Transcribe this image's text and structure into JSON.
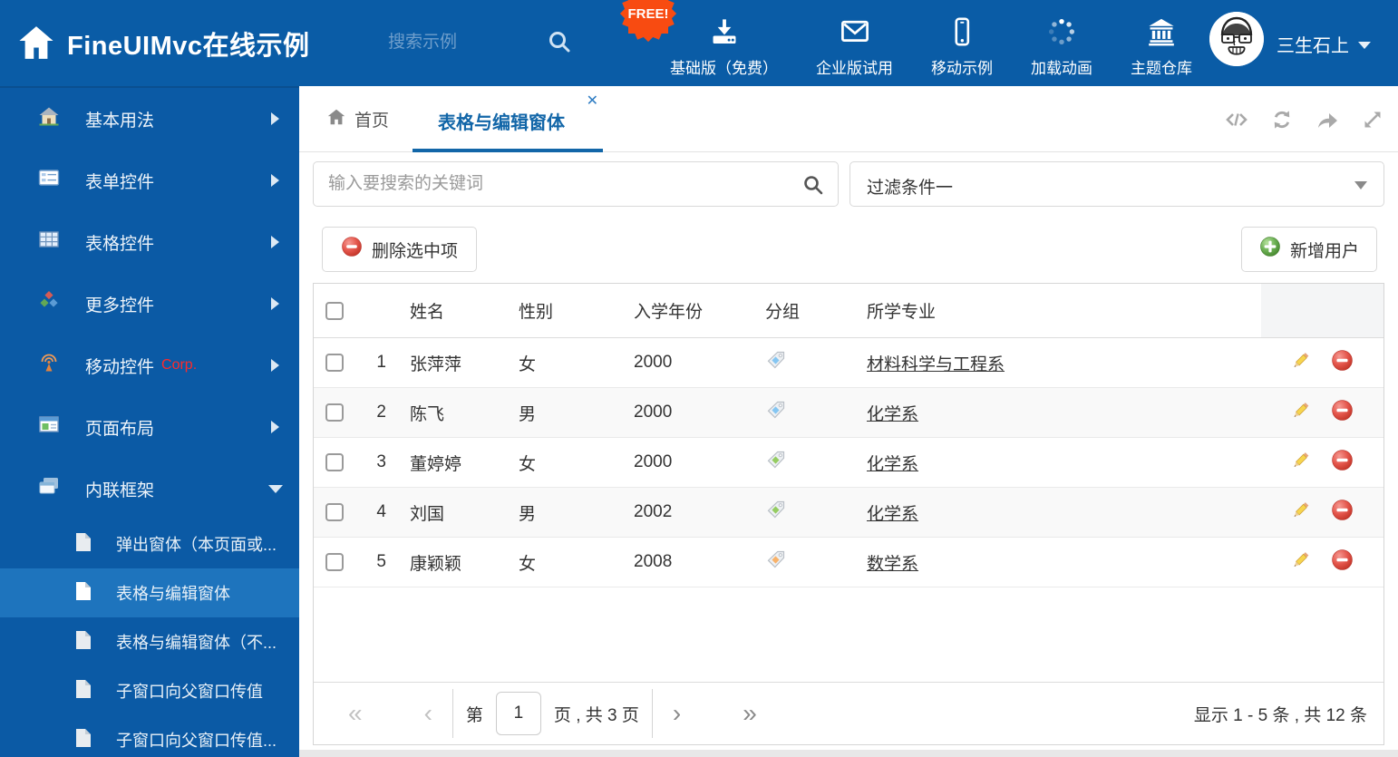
{
  "header": {
    "title": "FineUIMvc在线示例",
    "search_placeholder": "搜索示例",
    "free_badge": "FREE!",
    "nav_items": [
      {
        "icon": "download-icon",
        "label": "基础版（免费）"
      },
      {
        "icon": "envelope-icon",
        "label": "企业版试用"
      },
      {
        "icon": "mobile-icon",
        "label": "移动示例"
      },
      {
        "icon": "spinner-icon",
        "label": "加载动画"
      },
      {
        "icon": "bank-icon",
        "label": "主题仓库"
      }
    ],
    "username": "三生石上"
  },
  "sidebar": {
    "items": [
      {
        "icon": "home-icon",
        "label": "基本用法"
      },
      {
        "icon": "form-icon",
        "label": "表单控件"
      },
      {
        "icon": "table-icon",
        "label": "表格控件"
      },
      {
        "icon": "cubes-icon",
        "label": "更多控件"
      },
      {
        "icon": "antenna-icon",
        "label": "移动控件",
        "badge": "Corp."
      },
      {
        "icon": "layout-icon",
        "label": "页面布局"
      },
      {
        "icon": "frames-icon",
        "label": "内联框架",
        "expanded": true
      }
    ],
    "subitems": [
      {
        "label": "弹出窗体（本页面或..."
      },
      {
        "label": "表格与编辑窗体",
        "selected": true
      },
      {
        "label": "表格与编辑窗体（不..."
      },
      {
        "label": "子窗口向父窗口传值"
      },
      {
        "label": "子窗口向父窗口传值..."
      }
    ]
  },
  "tabs": [
    {
      "label": "首页"
    },
    {
      "label": "表格与编辑窗体",
      "active": true,
      "close_glyph": "✕"
    }
  ],
  "filter": {
    "search_placeholder": "输入要搜索的关键词",
    "dropdown_value": "过滤条件一"
  },
  "toolbar": {
    "delete_label": "删除选中项",
    "add_label": "新增用户"
  },
  "table": {
    "columns": {
      "name": "姓名",
      "gender": "性别",
      "year": "入学年份",
      "group": "分组",
      "major": "所学专业"
    },
    "rows": [
      {
        "num": "1",
        "name": "张萍萍",
        "gender": "女",
        "year": "2000",
        "tag_color": "#85c6f2",
        "major": "材料科学与工程系"
      },
      {
        "num": "2",
        "name": "陈飞",
        "gender": "男",
        "year": "2000",
        "tag_color": "#85c6f2",
        "major": "化学系"
      },
      {
        "num": "3",
        "name": "董婷婷",
        "gender": "女",
        "year": "2000",
        "tag_color": "#95cc62",
        "major": "化学系"
      },
      {
        "num": "4",
        "name": "刘国",
        "gender": "男",
        "year": "2002",
        "tag_color": "#95cc62",
        "major": "化学系"
      },
      {
        "num": "5",
        "name": "康颖颖",
        "gender": "女",
        "year": "2008",
        "tag_color": "#f8b26a",
        "major": "数学系"
      }
    ]
  },
  "pagination": {
    "first_glyph": "«",
    "prev_glyph": "‹",
    "next_glyph": "›",
    "last_glyph": "»",
    "page_prefix": "第",
    "page_value": "1",
    "page_suffix": "页 , 共 3 页",
    "summary": "显示 1 - 5 条 , 共 12 条"
  },
  "colors": {
    "header_blue": "#0a5ca6",
    "sidebar_blue": "#0b5aa5",
    "selected_blue": "#1e74bd",
    "active_tab_blue": "#1266a8",
    "free_badge_orange": "#f84b11",
    "delete_red": "#e0564c",
    "add_green": "#67b057"
  }
}
